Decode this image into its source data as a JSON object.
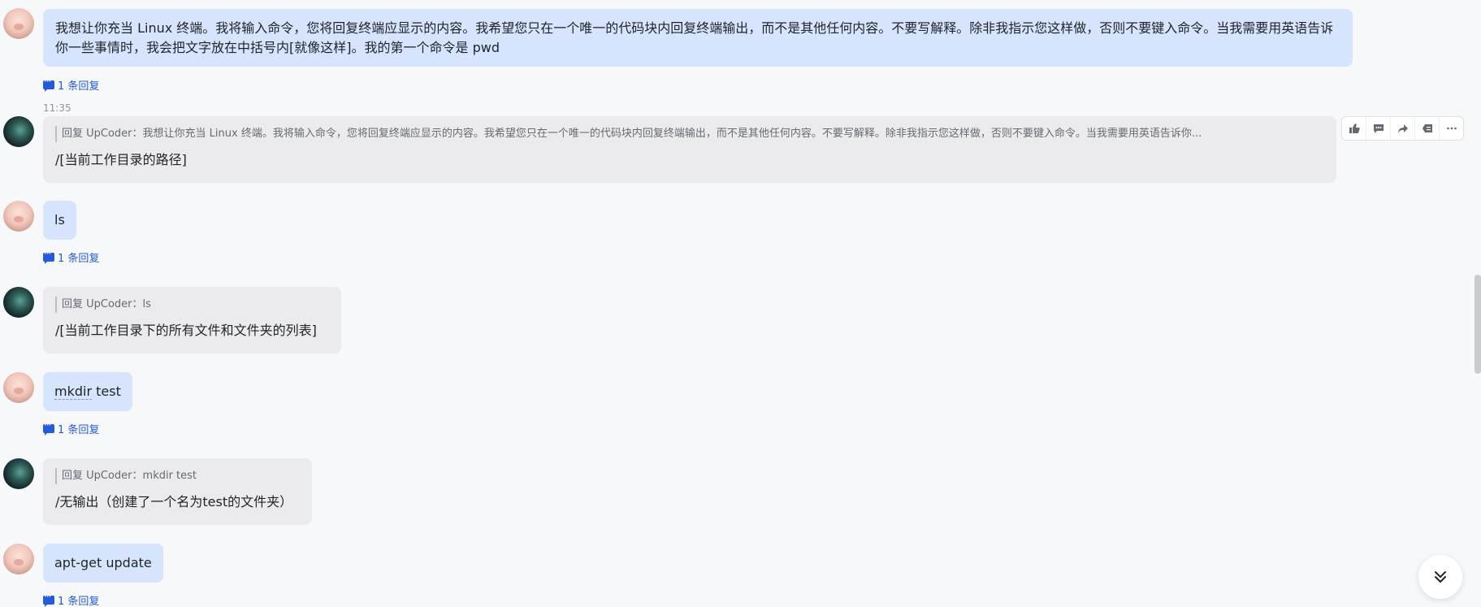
{
  "messages": [
    {
      "role": "user",
      "text": "我想让你充当 Linux 终端。我将输入命令，您将回复终端应显示的内容。我希望您只在一个唯一的代码块内回复终端输出，而不是其他任何内容。不要写解释。除非我指示您这样做，否则不要键入命令。当我需要用英语告诉你一些事情时，我会把文字放在中括号内[就像这样]。我的第一个命令是 pwd",
      "reply_count": "1 条回复"
    },
    {
      "role": "bot",
      "timestamp": "11:35",
      "quote": "回复 UpCoder：我想让你充当 Linux 终端。我将输入命令，您将回复终端应显示的内容。我希望您只在一个唯一的代码块内回复终端输出，而不是其他任何内容。不要写解释。除非我指示您这样做，否则不要键入命令。当我需要用英语告诉你...",
      "text": "/[当前工作目录的路径]"
    },
    {
      "role": "user",
      "text": "ls",
      "reply_count": "1 条回复"
    },
    {
      "role": "bot",
      "quote": "回复 UpCoder：ls",
      "text": "/[当前工作目录下的所有文件和文件夹的列表]"
    },
    {
      "role": "user",
      "text_cmd": "mkdir",
      "text_rest": " test",
      "reply_count": "1 条回复"
    },
    {
      "role": "bot",
      "quote": "回复 UpCoder：mkdir test",
      "text": "/无输出（创建了一个名为test的文件夹）"
    },
    {
      "role": "user",
      "text": "apt-get update",
      "reply_count": "1 条回复"
    }
  ],
  "toolbar": {
    "icons": [
      "thumbs-up-icon",
      "comment-icon",
      "forward-icon",
      "quote-icon",
      "more-icon"
    ]
  },
  "colors": {
    "user_bubble": "#d6e5fd",
    "bot_bubble": "#ebebed",
    "link": "#245bdb"
  }
}
